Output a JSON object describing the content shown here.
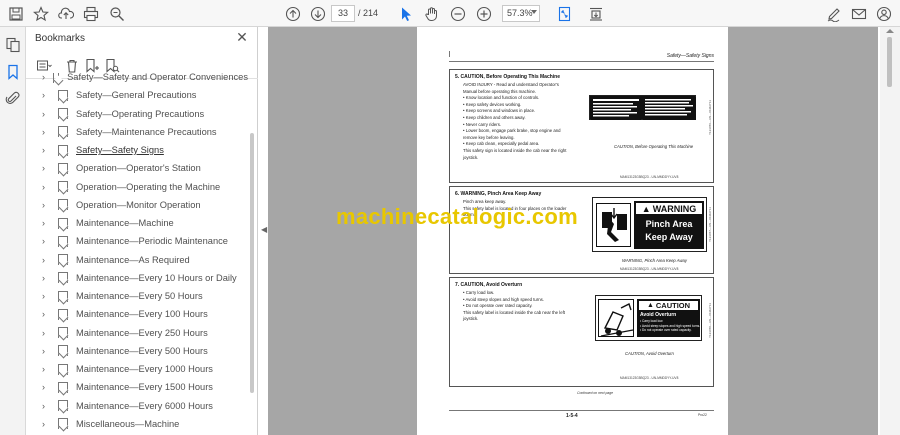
{
  "toolbar": {
    "page_current": "33",
    "page_total": "/ 214",
    "zoom": "57.3%"
  },
  "bookmarks": {
    "title": "Bookmarks",
    "close_glyph": "✕",
    "items": [
      {
        "label": "Safety—Safety and Operator Conveniences",
        "active": false
      },
      {
        "label": "Safety—General Precautions",
        "active": false
      },
      {
        "label": "Safety—Operating Precautions",
        "active": false
      },
      {
        "label": "Safety—Maintenance Precautions",
        "active": false
      },
      {
        "label": "Safety—Safety Signs",
        "active": true
      },
      {
        "label": "Operation—Operator's Station",
        "active": false
      },
      {
        "label": "Operation—Operating the Machine",
        "active": false
      },
      {
        "label": "Operation—Monitor Operation",
        "active": false
      },
      {
        "label": "Maintenance—Machine",
        "active": false
      },
      {
        "label": "Maintenance—Periodic Maintenance",
        "active": false
      },
      {
        "label": "Maintenance—As Required",
        "active": false
      },
      {
        "label": "Maintenance—Every 10 Hours or Daily",
        "active": false
      },
      {
        "label": "Maintenance—Every 50 Hours",
        "active": false
      },
      {
        "label": "Maintenance—Every 100 Hours",
        "active": false
      },
      {
        "label": "Maintenance—Every 250 Hours",
        "active": false
      },
      {
        "label": "Maintenance—Every 500 Hours",
        "active": false
      },
      {
        "label": "Maintenance—Every 1000 Hours",
        "active": false
      },
      {
        "label": "Maintenance—Every 1500 Hours",
        "active": false
      },
      {
        "label": "Maintenance—Every 6000 Hours",
        "active": false
      },
      {
        "label": "Miscellaneous—Machine",
        "active": false
      }
    ]
  },
  "page": {
    "header": "Safety—Safety Signs",
    "sec5": {
      "title": "5.  CAUTION, Before Operating This Machine",
      "lines": [
        "AVOID INJURY - Read and understand Operator's",
        "Manual before operating this machine.",
        "• Know location and function of controls.",
        "• Keep safety devices working.",
        "• Keep screens and windows in place.",
        "• Keep children and others away.",
        "• Never carry riders.",
        "• Lower boom, engage park brake, stop engine and",
        "remove key before leaving.",
        "• Keep cab clean, especially pedal area.",
        "This safety sign is located inside the cab near the right",
        "joystick."
      ],
      "caption": "CAUTION, Before Operating This Machine",
      "code": "MAM13123G5BQ23 - UN-MMDDYY-UV8"
    },
    "sec6": {
      "title": "6.  WARNING, Pinch Area Keep Away",
      "lines": [
        "Pinch area keep away.",
        "This safety label is located in four places on the loader",
        "boom."
      ],
      "sign_header": "WARNING",
      "sign_line1": "Pinch Area",
      "sign_line2": "Keep Away",
      "caption": "WARNING, Pinch Area Keep Away",
      "code": "MAM13123G5BQ23 - UN-MMDDYY-UV8"
    },
    "sec7": {
      "title": "7.  CAUTION, Avoid Overturn",
      "lines": [
        "• Carry load low.",
        "• Avoid steep slopes and high speed turns.",
        "• Do not operate over rated capacity.",
        "This safety label is located inside the cab near the left",
        "joystick."
      ],
      "sign_header": "CAUTION",
      "sign_sub": "Avoid Overturn",
      "sign_lines": [
        "• Carry load low.",
        "• Avoid steep slopes and high speed turns.",
        "• Do not operate over rated capacity."
      ],
      "caption": "CAUTION, Avoid Overturn",
      "code": "MAM13123G5BQ23 - UN-MMDDYY-UV8"
    },
    "continued": "Continued on next page",
    "page_number": "1-5-4",
    "footer_right": "Pro22"
  },
  "watermark": "machinecatalogic.com",
  "colors": {
    "watermark": "#e8c700",
    "doc_background": "#a6a6a6"
  }
}
